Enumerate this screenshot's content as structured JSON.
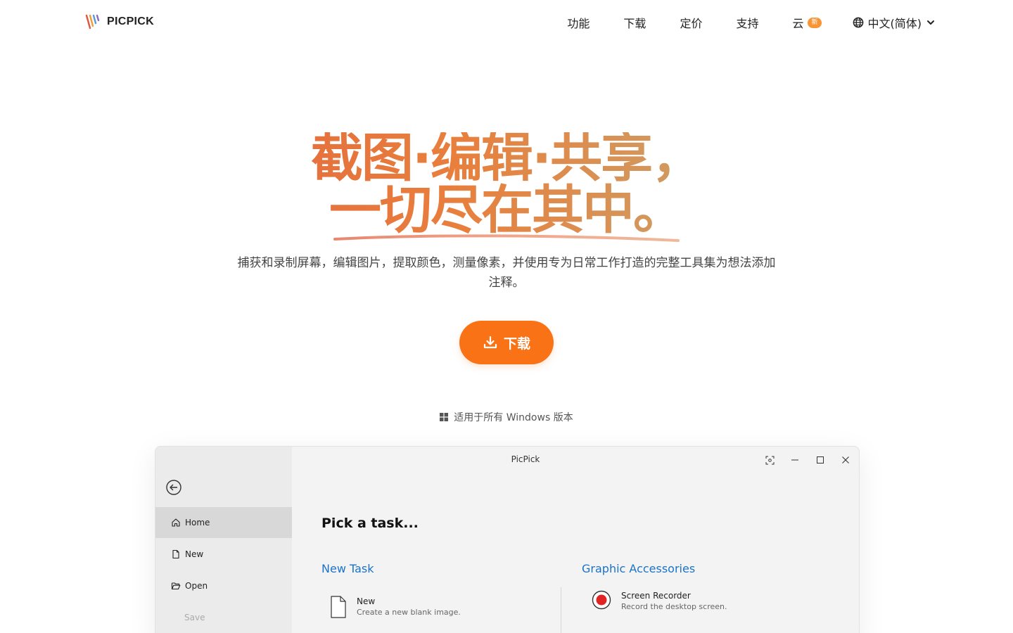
{
  "header": {
    "logo_text": "PICPICK",
    "nav": [
      "功能",
      "下载",
      "定价",
      "支持"
    ],
    "cloud": {
      "label": "云",
      "badge": "新"
    },
    "language": "中文(简体)"
  },
  "hero": {
    "title_line1": "截图·编辑·共享，",
    "title_line2": "一切尽在其中。",
    "subtitle": "捕获和录制屏幕，编辑图片，提取颜色，测量像素，并使用专为日常工作打造的完整工具集为想法添加注释。",
    "download_label": "下载",
    "platform_note": "适用于所有 Windows 版本"
  },
  "app_window": {
    "title": "PicPick",
    "sidebar": [
      {
        "label": "Home",
        "icon": "home-icon"
      },
      {
        "label": "New",
        "icon": "file-icon"
      },
      {
        "label": "Open",
        "icon": "folder-open-icon"
      },
      {
        "label": "Save",
        "icon": ""
      }
    ],
    "heading": "Pick a task...",
    "new_task": {
      "title": "New Task",
      "items": [
        {
          "name": "New",
          "desc": "Create a new blank image."
        }
      ]
    },
    "graphic_accessories": {
      "title": "Graphic Accessories",
      "items": [
        {
          "name": "Screen Recorder",
          "desc": "Record the desktop screen."
        }
      ]
    }
  },
  "colors": {
    "accent": "#f97316",
    "badge": "#f79433",
    "link_blue": "#1a73c8",
    "record_red": "#e02424"
  }
}
